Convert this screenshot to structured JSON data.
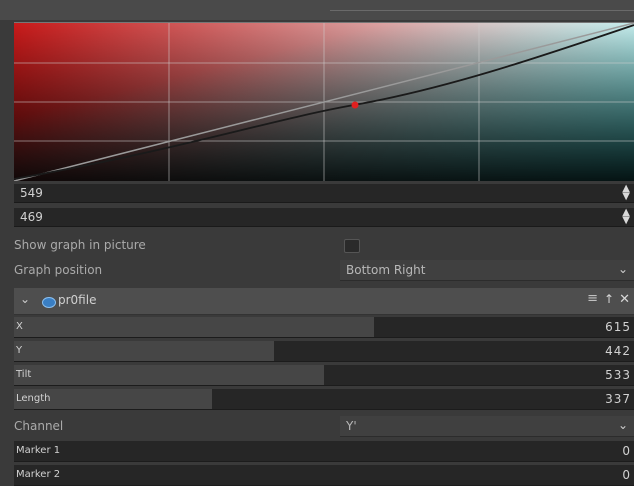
{
  "curve": {
    "point_color": "#e02020"
  },
  "spin1": {
    "value": "549"
  },
  "spin2": {
    "value": "469"
  },
  "show_graph": {
    "label": "Show graph in picture",
    "checked": false
  },
  "graph_position": {
    "label": "Graph position",
    "value": "Bottom Right"
  },
  "module": {
    "name": "pr0file",
    "expanded": true
  },
  "sliders": [
    {
      "label": "X",
      "value": "615",
      "fill_fraction": 0.58
    },
    {
      "label": "Y",
      "value": "442",
      "fill_fraction": 0.42
    },
    {
      "label": "Tilt",
      "value": "533",
      "fill_fraction": 0.5
    },
    {
      "label": "Length",
      "value": "337",
      "fill_fraction": 0.32
    }
  ],
  "channel": {
    "label": "Channel",
    "value": "Y'"
  },
  "markers": [
    {
      "label": "Marker 1",
      "value": "0",
      "fill_fraction": 0
    },
    {
      "label": "Marker 2",
      "value": "0",
      "fill_fraction": 0
    }
  ]
}
